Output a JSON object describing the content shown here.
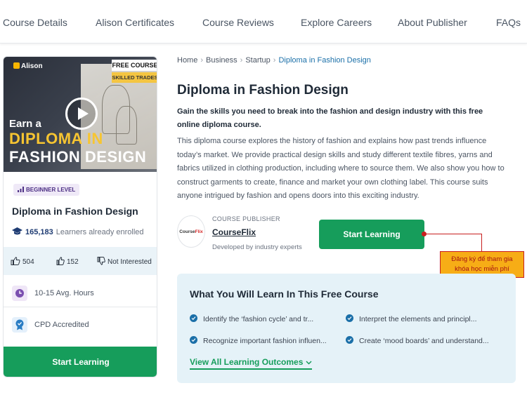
{
  "nav": {
    "items": [
      "Course Details",
      "Alison Certificates",
      "Course Reviews",
      "Explore Careers",
      "About Publisher",
      "FAQs"
    ]
  },
  "card": {
    "thumbnail": {
      "logo": "Alison",
      "free_badge": "FREE COURSE",
      "skill_badge": "SKILLED TRADES",
      "line1": "Earn a",
      "line2": "DIPLOMA IN",
      "line3": "FASHION DESIGN"
    },
    "level": "BEGINNER LEVEL",
    "title": "Diploma in Fashion Design",
    "enrolled_count": "165,183",
    "enrolled_label": "Learners already enrolled",
    "likes": "504",
    "thumbs_up": "152",
    "not_interested": "Not Interested",
    "hours": "10-15 Avg. Hours",
    "accreditation": "CPD Accredited",
    "cta": "Start Learning"
  },
  "breadcrumb": [
    "Home",
    "Business",
    "Startup",
    "Diploma in Fashion Design"
  ],
  "main": {
    "title": "Diploma in Fashion Design",
    "lead": "Gain the skills you need to break into the fashion and design industry with this free online diploma course.",
    "description": "This diploma course explores the history of fashion and explains how past trends influence today’s market. We provide practical design skills and study different textile fibres, yarns and fabrics utilized in clothing production, including where to source them. We also show you how to construct garments to create, finance and market your own clothing label. This course suits anyone intrigued by fashion and opens doors into this exciting industry."
  },
  "publisher": {
    "logo_text_a": "Course",
    "logo_text_b": "Flix",
    "label": "COURSE PUBLISHER",
    "name": "CourseFlix",
    "subtitle": "Developed by industry experts"
  },
  "start_button": "Start Learning",
  "annotation": {
    "line1": "Đăng ký để tham gia",
    "line2": "khóa học miễn phí"
  },
  "learn": {
    "title": "What You Will Learn In This Free Course",
    "outcomes": [
      "Identify the ‘fashion cycle’ and tr...",
      "Interpret the elements and principl...",
      "Recognize important fashion influen...",
      "Create ‘mood boards’ and understand..."
    ],
    "view_all": "View All Learning Outcomes"
  },
  "colors": {
    "accent_green": "#169d5b",
    "link_blue": "#1a6fa8",
    "annotation_orange": "#f7ad16",
    "annotation_red": "#c81e1e"
  }
}
